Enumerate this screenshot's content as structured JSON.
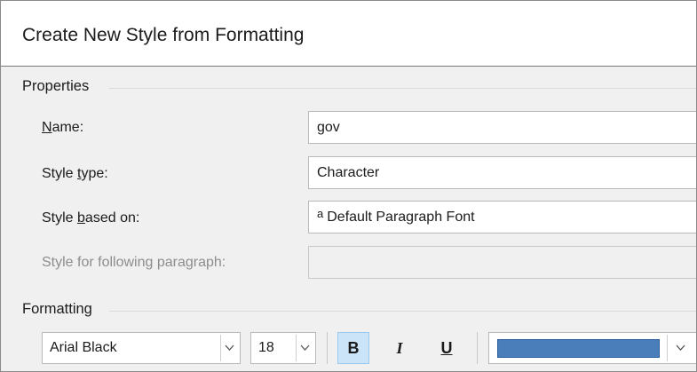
{
  "dialog": {
    "title": "Create New Style from Formatting"
  },
  "properties": {
    "heading": "Properties",
    "name": {
      "label_pre": "",
      "label_u": "N",
      "label_post": "ame:",
      "value": "gov"
    },
    "style_type": {
      "label_pre": "Style ",
      "label_u": "t",
      "label_post": "ype:",
      "value": "Character"
    },
    "based_on": {
      "label_pre": "Style ",
      "label_u": "b",
      "label_post": "ased on:",
      "glyph": "a",
      "value": "Default Paragraph Font"
    },
    "following": {
      "label": "Style for following paragraph:",
      "value": ""
    }
  },
  "formatting": {
    "heading": "Formatting",
    "font": "Arial Black",
    "size": "18",
    "bold_label": "B",
    "bold_active": true,
    "italic_label": "I",
    "underline_label": "U",
    "font_color": "#4a7ebb"
  }
}
